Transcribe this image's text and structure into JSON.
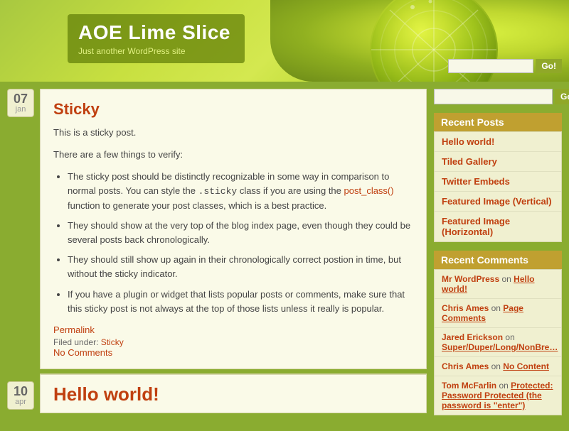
{
  "site": {
    "title": "AOE Lime Slice",
    "subtitle": "Just another WordPress site"
  },
  "header": {
    "search_placeholder": "",
    "search_button": "Go!",
    "go_label": "Go!"
  },
  "sidebar": {
    "search_button": "Go!",
    "recent_posts_title": "Recent Posts",
    "recent_posts": [
      {
        "label": "Hello world!"
      },
      {
        "label": "Tiled Gallery"
      },
      {
        "label": "Twitter Embeds"
      },
      {
        "label": "Featured Image (Vertical)"
      },
      {
        "label": "Featured Image (Horizontal)"
      }
    ],
    "recent_comments_title": "Recent Comments",
    "recent_comments": [
      {
        "commenter": "Mr WordPress",
        "on": "on",
        "post": "Hello world!"
      },
      {
        "commenter": "Chris Ames",
        "on": "on",
        "post": "Page Comments"
      },
      {
        "commenter": "Jared Erickson",
        "on": "",
        "post": "Super/Duper/Long/NonBre…"
      },
      {
        "commenter": "Chris Ames",
        "on": "on",
        "post": "No Content"
      },
      {
        "commenter": "Tom McFarlin",
        "on": "on",
        "post": "Protected: Password Protected (the password is \"enter\")"
      }
    ]
  },
  "posts": [
    {
      "day": "07",
      "month": "jan",
      "title": "Sticky",
      "intro": "This is a sticky post.",
      "second_para": "There are a few things to verify:",
      "bullets": [
        "The sticky post should be distinctly recognizable in some way in comparison to normal posts. You can style the .sticky class if you are using the post_class() function to generate your post classes, which is a best practice.",
        "They should show at the very top of the blog index page, even though they could be several posts back chronologically.",
        "They should still show up again in their chronologically correct postion in time, but without the sticky indicator.",
        "If you have a plugin or widget that lists popular posts or comments, make sure that this sticky post is not always at the top of those lists unless it really is popular."
      ],
      "permalink_label": "Permalink",
      "filed_under_label": "Filed under:",
      "category": "Sticky",
      "no_comments": "No Comments"
    },
    {
      "day": "10",
      "month": "apr",
      "title": "Hello world!"
    }
  ]
}
